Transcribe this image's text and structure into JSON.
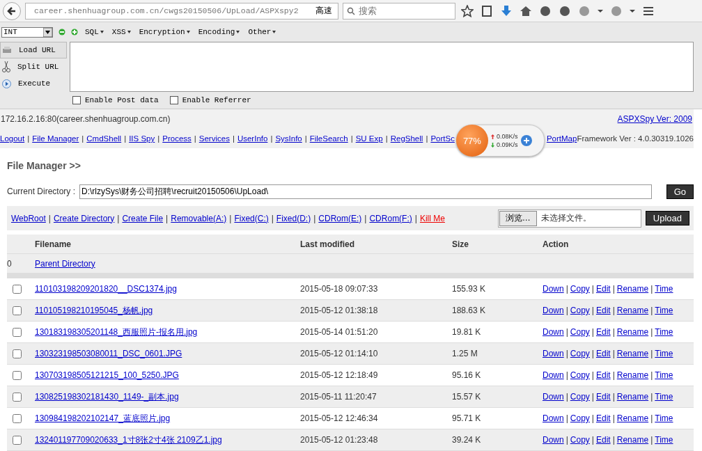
{
  "browser": {
    "address_host": "career.shenhuagroup.com.cn",
    "address_path": "/cwgs20150506/UpLoad/ASPXspy2",
    "speed_label": "高速",
    "search_placeholder": "搜索"
  },
  "hackbar": {
    "type_select": "INT",
    "menus": [
      "SQL",
      "XSS",
      "Encryption",
      "Encoding",
      "Other"
    ],
    "actions": [
      {
        "kind": "load",
        "label": "Load URL",
        "selected": true
      },
      {
        "kind": "split",
        "label": "Split URL",
        "selected": false
      },
      {
        "kind": "execute",
        "label": "Execute",
        "selected": false
      }
    ],
    "options": [
      {
        "label": "Enable Post data",
        "checked": false
      },
      {
        "label": "Enable Referrer",
        "checked": false
      }
    ]
  },
  "page": {
    "host": "172.16.2.16:80(career.shenhuagroup.com.cn)",
    "version_link": "ASPXSpy Ver: 2009",
    "separator": "|",
    "nav": [
      "Logout",
      "File Manager",
      "CmdShell",
      "IIS Spy",
      "Process",
      "Services",
      "UserInfo",
      "SysInfo",
      "FileSearch",
      "SU Exp",
      "RegShell",
      "PortSc",
      "PortMap"
    ],
    "framework": "Framework Ver : 4.0.30319.1026",
    "monitor": {
      "percent": "77%",
      "up": "0.08K/s",
      "down": "0.09K/s"
    },
    "section_title": "File Manager >>",
    "directory": {
      "label": "Current Directory :",
      "value": "D:\\rlzySys\\财务公司招聘\\recruit20150506\\UpLoad\\",
      "button": "Go"
    },
    "drive_links": [
      {
        "label": "WebRoot",
        "kind": "link"
      },
      {
        "label": "Create Directory",
        "kind": "link"
      },
      {
        "label": "Create File",
        "kind": "link"
      },
      {
        "label": "Removable(A:)",
        "kind": "link"
      },
      {
        "label": "Fixed(C:)",
        "kind": "link"
      },
      {
        "label": "Fixed(D:)",
        "kind": "link"
      },
      {
        "label": "CDRom(E:)",
        "kind": "link"
      },
      {
        "label": "CDRom(F:)",
        "kind": "link"
      },
      {
        "label": "Kill Me",
        "kind": "danger"
      }
    ],
    "upload": {
      "browse": "浏览…",
      "status": "未选择文件。",
      "button": "Upload"
    },
    "table": {
      "columns": [
        "Filename",
        "Last modified",
        "Size",
        "Action"
      ],
      "parent": {
        "index": "0",
        "label": "Parent Directory"
      },
      "rows": [
        {
          "checked": false,
          "filename": "110103198209201820__DSC1374.jpg",
          "modified": "2015-05-18 09:07:33",
          "size": "155.93 K",
          "actions": [
            "Down",
            "Copy",
            "Edit",
            "Rename",
            "Time"
          ]
        },
        {
          "checked": false,
          "filename": "110105198210195045_杨帆.jpg",
          "modified": "2015-05-12 01:38:18",
          "size": "188.63 K",
          "actions": [
            "Down",
            "Copy",
            "Edit",
            "Rename",
            "Time"
          ]
        },
        {
          "checked": false,
          "filename": "130183198305201148_西服照片-报名用.jpg",
          "modified": "2015-05-14 01:51:20",
          "size": "19.81 K",
          "actions": [
            "Down",
            "Copy",
            "Edit",
            "Rename",
            "Time"
          ]
        },
        {
          "checked": false,
          "filename": "130323198503080011_DSC_0601.JPG",
          "modified": "2015-05-12 01:14:10",
          "size": "1.25 M",
          "actions": [
            "Down",
            "Copy",
            "Edit",
            "Rename",
            "Time"
          ]
        },
        {
          "checked": false,
          "filename": "130703198505121215_100_5250.JPG",
          "modified": "2015-05-12 12:18:49",
          "size": "95.16 K",
          "actions": [
            "Down",
            "Copy",
            "Edit",
            "Rename",
            "Time"
          ]
        },
        {
          "checked": false,
          "filename": "130825198302181430_1149-_副本.jpg",
          "modified": "2015-05-11 11:20:47",
          "size": "15.57 K",
          "actions": [
            "Down",
            "Copy",
            "Edit",
            "Rename",
            "Time"
          ]
        },
        {
          "checked": false,
          "filename": "130984198202102147_蓝底照片.jpg",
          "modified": "2015-05-12 12:46:34",
          "size": "95.71 K",
          "actions": [
            "Down",
            "Copy",
            "Edit",
            "Rename",
            "Time"
          ]
        },
        {
          "checked": false,
          "filename": "132401197709020633_1寸8张2寸4张 2109乙1.jpg",
          "modified": "2015-05-12 01:23:48",
          "size": "39.24 K",
          "actions": [
            "Down",
            "Copy",
            "Edit",
            "Rename",
            "Time"
          ]
        }
      ]
    }
  }
}
